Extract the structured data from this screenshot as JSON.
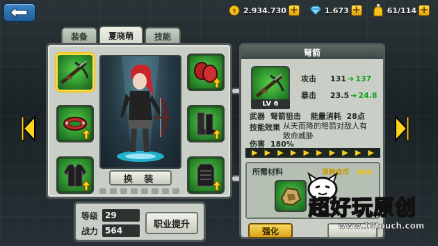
{
  "resources": {
    "gold": "2.934.730",
    "diamonds": "1.673",
    "stamina": "61/114"
  },
  "tabs": [
    "装备",
    "夏晓萌",
    "技能"
  ],
  "active_tab_index": 1,
  "character": {
    "swap_label": "换 装"
  },
  "stats": {
    "level_label": "等级",
    "level_value": "29",
    "power_label": "战力",
    "power_value": "564",
    "job_button": "职业提升"
  },
  "item": {
    "title": "弩箭",
    "level": "LV 6",
    "attack_label": "攻击",
    "attack_old": "131",
    "attack_new": "137",
    "crit_label": "暴击",
    "crit_old": "23.5",
    "crit_new": "24.8",
    "weapon_label": "武器",
    "weapon_value": "弩箭狙击",
    "energy_label": "能量消耗",
    "energy_value": "28点",
    "effect_label": "技能效果",
    "effect_value": "从天而降的弩箭对敌人有致命威胁",
    "damage_label": "伤害",
    "damage_value": "180%"
  },
  "materials": {
    "title": "所需材料",
    "cost_label": "消耗金币",
    "cost_value": "800"
  },
  "forge_button": "强化",
  "watermark": {
    "main": "超好玩原创",
    "sub": "www.18touch.com"
  },
  "colors": {
    "accent_yellow": "#f5d21b",
    "slot_green": "#2a8a2b",
    "stat_up_green": "#14a11f"
  }
}
